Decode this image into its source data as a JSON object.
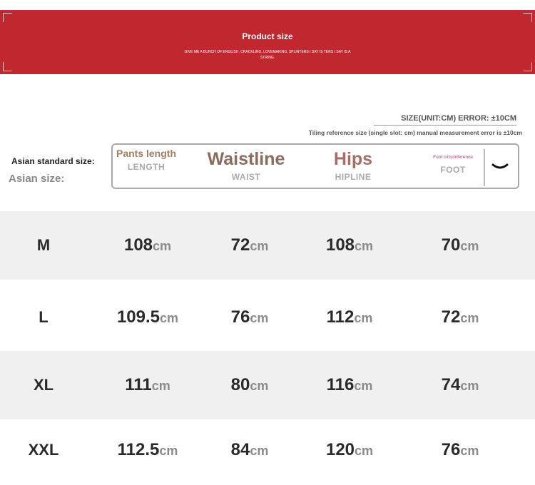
{
  "banner": {
    "title": "Product size",
    "subtitle": "GIVE ME A BUNCH OF ENGLISH, CRACKLING, LOVEMAKING, SPLINTERS I SAY IS TERS I SAY IS A STRING."
  },
  "note": {
    "size_unit": "SIZE(UNIT:CM) ERROR: ±10CM",
    "tiling": "Tiling reference size (single slot: cm) manual measurement error is ±10cm"
  },
  "labels": {
    "asian_standard": "Asian standard size:",
    "asian_size": "Asian size:"
  },
  "headers": [
    {
      "title": "Pants length",
      "sub": "LENGTH"
    },
    {
      "title": "Waistline",
      "sub": "WAIST"
    },
    {
      "title": "Hips",
      "sub": "HIPLINE"
    },
    {
      "title": "Foot circumference",
      "sub": "FOOT"
    }
  ],
  "unit": "cm",
  "rows": [
    {
      "size": "M",
      "values": [
        "108",
        "72",
        "108",
        "70"
      ]
    },
    {
      "size": "L",
      "values": [
        "109.5",
        "76",
        "112",
        "72"
      ]
    },
    {
      "size": "XL",
      "values": [
        "111",
        "80",
        "116",
        "74"
      ]
    },
    {
      "size": "XXL",
      "values": [
        "112.5",
        "84",
        "120",
        "76"
      ]
    }
  ],
  "icons": {
    "expand": "chevron-down-icon"
  }
}
